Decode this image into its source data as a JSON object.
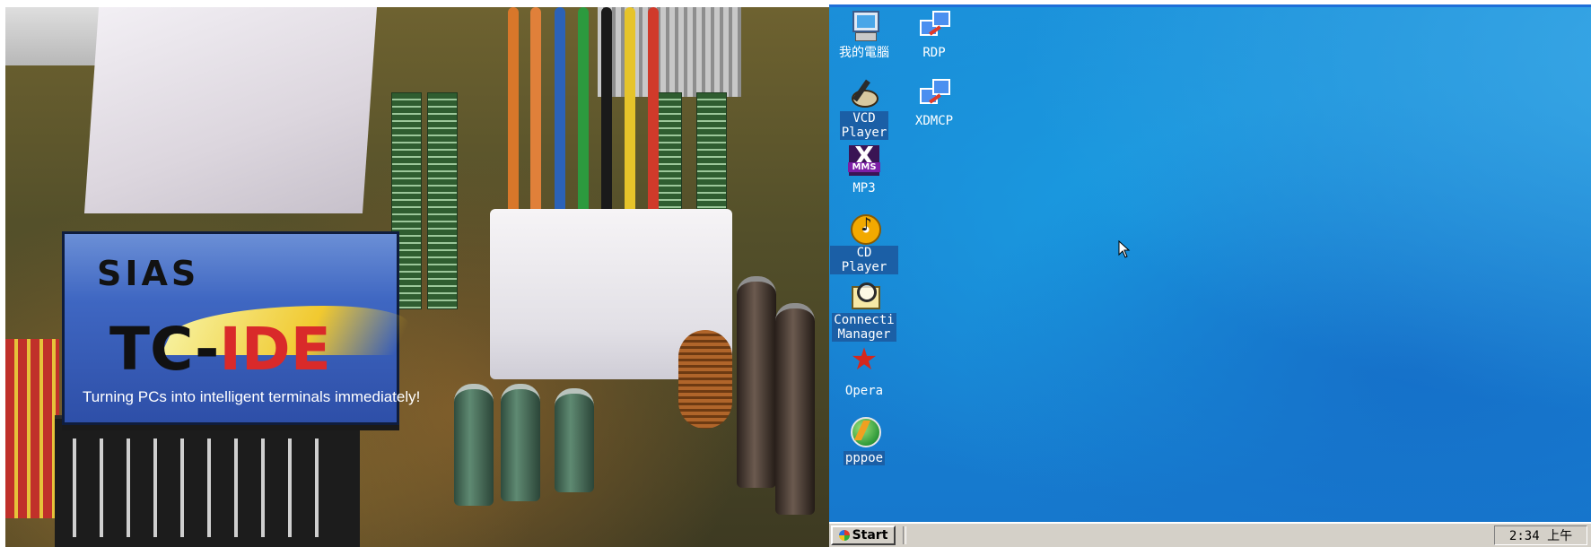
{
  "photo": {
    "brand": "SIAS",
    "product_prefix": "TC-",
    "product_suffix": "IDE",
    "slogan": "Turning PCs into intelligent terminals immediately!"
  },
  "desktop": {
    "icons": [
      {
        "label": "我的電腦",
        "icon": "my-computer-icon"
      },
      {
        "label": "RDP",
        "icon": "network-computers-icon"
      },
      {
        "label_line1": "VCD",
        "label_line2": "Player",
        "icon": "vcd-player-icon"
      },
      {
        "label": "XDMCP",
        "icon": "network-computers-icon"
      },
      {
        "label": "MP3",
        "icon": "mms-mp3-icon",
        "badge": "MMS"
      },
      {
        "label": "CD Player",
        "icon": "cd-player-icon"
      },
      {
        "label_line1": "Connecti",
        "label_line2": "Manager",
        "icon": "connection-manager-icon"
      },
      {
        "label": "Opera",
        "icon": "opera-icon"
      },
      {
        "label": "pppoe",
        "icon": "pppoe-icon"
      }
    ]
  },
  "taskbar": {
    "start_label": "Start",
    "clock": "2:34 上午"
  },
  "colors": {
    "desktop_blue": "#1b8fd9",
    "taskbar_gray": "#d4d0c8",
    "selected_label_bg": "#1b5fa6"
  }
}
